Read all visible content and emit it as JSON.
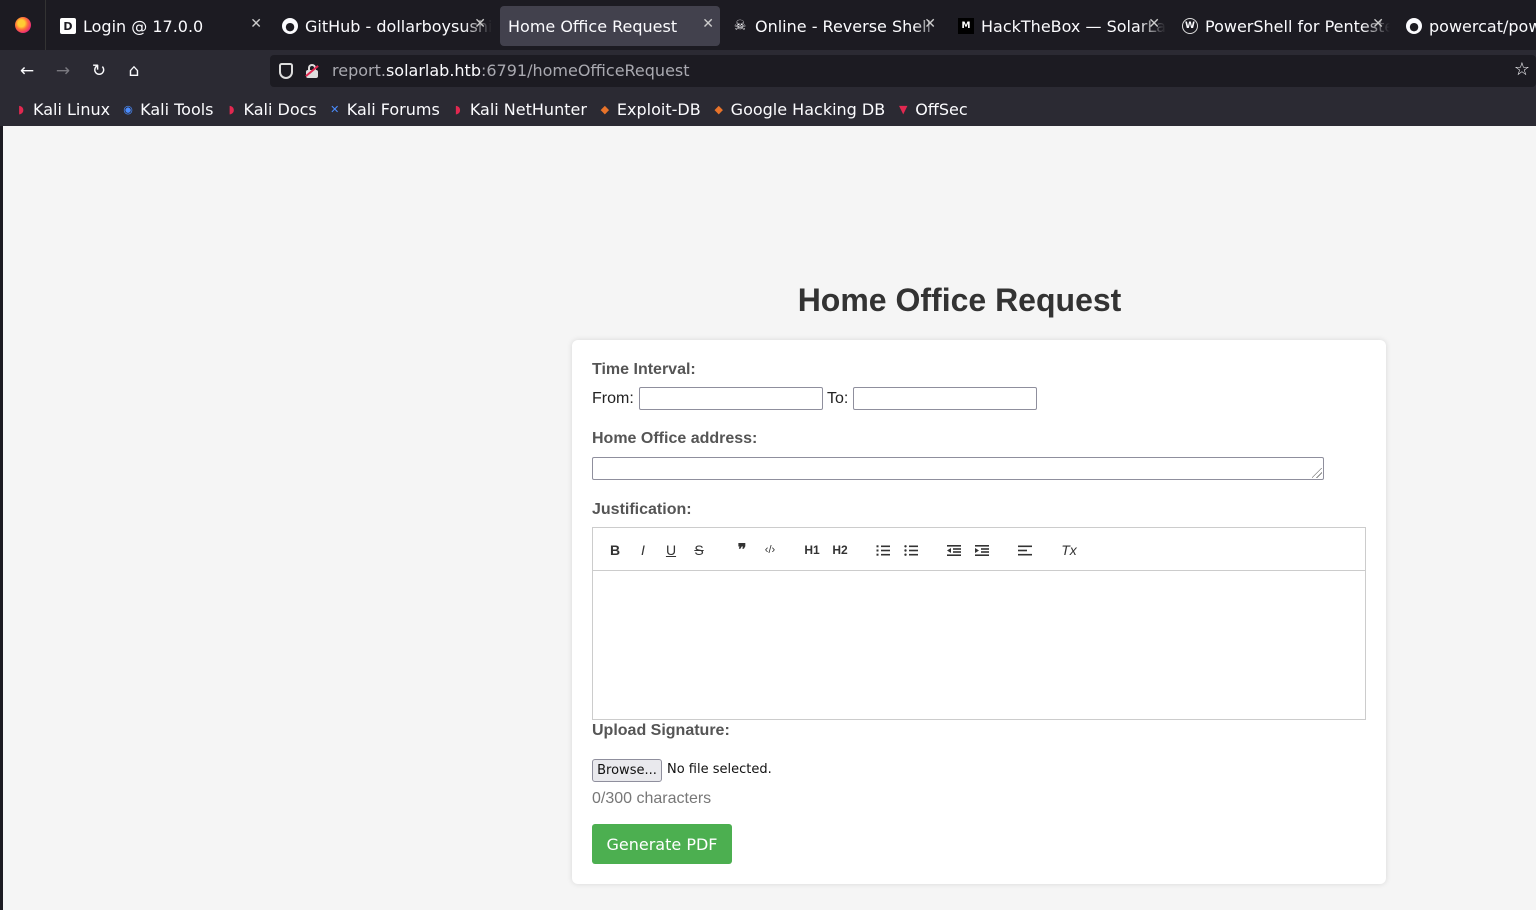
{
  "tabs": [
    {
      "label": "Login @ 17.0.0",
      "icon": "dollar-d-icon",
      "active": false
    },
    {
      "label": "GitHub - dollarboysushil",
      "icon": "github-icon",
      "active": false
    },
    {
      "label": "Home Office Request",
      "icon": "",
      "active": true
    },
    {
      "label": "Online - Reverse Shell",
      "icon": "skull-icon",
      "active": false
    },
    {
      "label": "HackTheBox — SolarLab",
      "icon": "medium-icon",
      "active": false
    },
    {
      "label": "PowerShell for Pentesters",
      "icon": "wordpress-icon",
      "active": false
    },
    {
      "label": "powercat/powercat",
      "icon": "github-icon",
      "active": false
    }
  ],
  "url": {
    "prefix": "report.",
    "host": "solarlab.htb",
    "rest": ":6791/homeOfficeRequest"
  },
  "bookmarks": [
    {
      "label": "Kali Linux",
      "icon": "kali-icon"
    },
    {
      "label": "Kali Tools",
      "icon": "kali-tools-icon"
    },
    {
      "label": "Kali Docs",
      "icon": "kali-icon"
    },
    {
      "label": "Kali Forums",
      "icon": "kali-forums-icon"
    },
    {
      "label": "Kali NetHunter",
      "icon": "kali-icon"
    },
    {
      "label": "Exploit-DB",
      "icon": "exploit-db-icon"
    },
    {
      "label": "Google Hacking DB",
      "icon": "ghdb-icon"
    },
    {
      "label": "OffSec",
      "icon": "offsec-icon"
    }
  ],
  "form": {
    "title": "Home Office Request",
    "time_interval_label": "Time Interval:",
    "from_label": "From:",
    "to_label": "To:",
    "from_value": "",
    "to_value": "",
    "address_label": "Home Office address:",
    "address_value": "",
    "justification_label": "Justification:",
    "toolbar": {
      "bold": "B",
      "italic": "I",
      "underline": "U",
      "strike": "S",
      "quote": "❞",
      "code": "‹/›",
      "h1": "H1",
      "h2": "H2",
      "clean": "Tx"
    },
    "upload_label": "Upload Signature:",
    "browse_label": "Browse...",
    "no_file": "No file selected.",
    "counter": "0/300 characters",
    "submit_label": "Generate PDF"
  },
  "colors": {
    "submit": "#4caf50",
    "active_tab": "#42414d",
    "chrome": "#1c1b22"
  }
}
